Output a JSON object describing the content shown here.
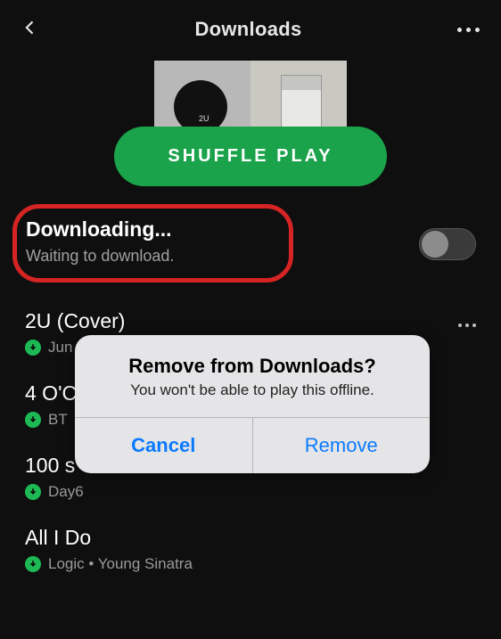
{
  "header": {
    "title": "Downloads"
  },
  "shuffle_label": "SHUFFLE PLAY",
  "art_label": "2U",
  "status": {
    "title": "Downloading...",
    "subtitle": "Waiting to download."
  },
  "tracks": [
    {
      "title": "2U (Cover)",
      "artist": "Jun"
    },
    {
      "title": "4 O'C",
      "artist": "BT"
    },
    {
      "title": "100 s",
      "artist": "Day6"
    },
    {
      "title": "All I Do",
      "artist": "Logic • Young Sinatra"
    }
  ],
  "alert": {
    "title": "Remove from Downloads?",
    "message": "You won't be able to play this offline.",
    "cancel": "Cancel",
    "confirm": "Remove"
  }
}
